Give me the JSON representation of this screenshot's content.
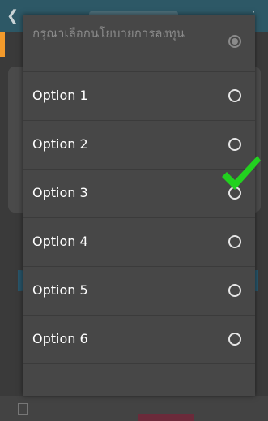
{
  "dialog": {
    "title": "กรุณาเลือกนโยบายการลงทุน",
    "options": [
      {
        "label": "Option 1"
      },
      {
        "label": "Option 2"
      },
      {
        "label": "Option 3"
      },
      {
        "label": "Option 4"
      },
      {
        "label": "Option 5"
      },
      {
        "label": "Option 6"
      }
    ]
  },
  "overlay": {
    "checkmark_icon": "green-checkmark-icon",
    "checkmark_color": "#22d11f",
    "annotated_option": "Option 3"
  },
  "background": {
    "appbar_color": "#2d5866",
    "accent_color": "#f39a2b"
  }
}
